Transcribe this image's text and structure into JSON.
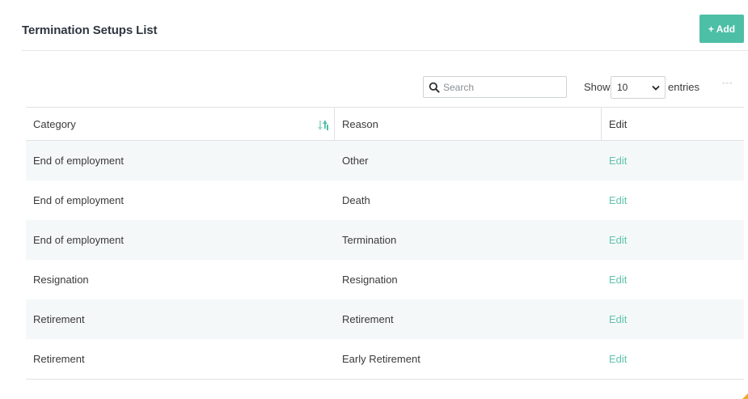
{
  "page": {
    "title": "Termination Setups List",
    "add_label": "+ Add"
  },
  "toolbar": {
    "search_placeholder": "Search",
    "show_label": "Show",
    "entries_value": "10",
    "entries_label": "entries",
    "more": "◦◦◦"
  },
  "table": {
    "headers": {
      "category": "Category",
      "reason": "Reason",
      "edit": "Edit"
    },
    "rows": [
      {
        "category": "End of employment",
        "reason": "Other",
        "action": "Edit"
      },
      {
        "category": "End of employment",
        "reason": "Death",
        "action": "Edit"
      },
      {
        "category": "End of employment",
        "reason": "Termination",
        "action": "Edit"
      },
      {
        "category": "Resignation",
        "reason": "Resignation",
        "action": "Edit"
      },
      {
        "category": "Retirement",
        "reason": "Retirement",
        "action": "Edit"
      },
      {
        "category": "Retirement",
        "reason": "Early Retirement",
        "action": "Edit"
      }
    ]
  },
  "colors": {
    "accent": "#4dbfa6",
    "link": "#5fc3ac",
    "row_alt": "#f5f8f8"
  },
  "icons": {
    "search": "search-icon",
    "sort": "sort-icon",
    "dropdown": "chevron-down-icon"
  }
}
